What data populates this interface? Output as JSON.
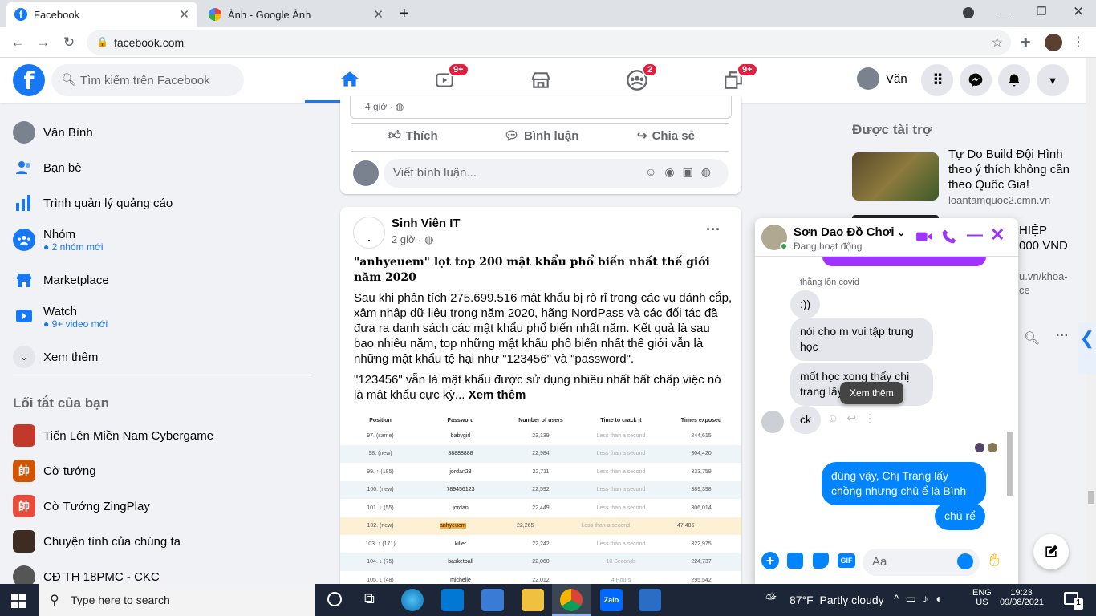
{
  "browser": {
    "tabs": [
      {
        "title": "Facebook"
      },
      {
        "title": "Ảnh - Google Ảnh"
      }
    ],
    "url": "facebook.com"
  },
  "header": {
    "search_placeholder": "Tìm kiếm trên Facebook",
    "user_name": "Văn",
    "badges": {
      "watch": "9+",
      "groups": "2",
      "gaming": "9+"
    }
  },
  "sidebar": {
    "items": [
      {
        "label": "Văn Bình",
        "sub": ""
      },
      {
        "label": "Bạn bè",
        "sub": ""
      },
      {
        "label": "Trình quản lý quảng cáo",
        "sub": ""
      },
      {
        "label": "Nhóm",
        "sub": "2 nhóm mới"
      },
      {
        "label": "Marketplace",
        "sub": ""
      },
      {
        "label": "Watch",
        "sub": "9+ video mới"
      },
      {
        "label": "Xem thêm",
        "sub": ""
      }
    ],
    "shortcuts_title": "Lối tắt của bạn",
    "shortcuts": [
      {
        "label": "Tiến Lên Miền Nam Cybergame"
      },
      {
        "label": "Cờ tướng"
      },
      {
        "label": "Cờ Tướng ZingPlay"
      },
      {
        "label": "Chuyện tình của chúng ta"
      },
      {
        "label": "CĐ TH 18PMC - CKC"
      }
    ]
  },
  "post1": {
    "time": "4 giờ ·",
    "like": "Thích",
    "comment": "Bình luận",
    "share": "Chia sẻ",
    "comment_placeholder": "Viết bình luận..."
  },
  "post2": {
    "author": "Sinh Viên IT",
    "time": "2 giờ ·",
    "headline": "\"anhyeuem\" lọt top 200 mật khẩu phổ biến nhất thế giới năm 2020",
    "body1": "Sau khi phân tích 275.699.516 mật khẩu bị rò rỉ trong các vụ đánh cắp, xâm nhập dữ liệu trong năm 2020, hãng NordPass và các đối tác đã đưa ra danh sách các mật khẩu phổ biến nhất năm. Kết quả là sau bao nhiêu năm, top những mật khẩu phổ biến nhất thế giới vẫn là những mật khẩu tệ hại như \"123456\" và \"password\".",
    "body2": "\"123456\" vẫn là mật khẩu được sử dụng nhiều nhất bất chấp việc nó là mật khẩu cực kỳ...",
    "see_more": "Xem thêm",
    "table": {
      "headers": [
        "Position",
        "Password",
        "Number of users",
        "Time to crack it",
        "Times exposed"
      ],
      "rows": [
        [
          "97. (same)",
          "babygirl",
          "23,139",
          "Less than a second",
          "244,615"
        ],
        [
          "98. (new)",
          "88888888",
          "22,984",
          "Less than a second",
          "304,420"
        ],
        [
          "99. ↑ (185)",
          "jordan23",
          "22,711",
          "Less than a second",
          "333,759"
        ],
        [
          "100. (new)",
          "789456123",
          "22,592",
          "Less than a second",
          "389,398"
        ],
        [
          "101. ↓ (55)",
          "jordan",
          "22,449",
          "Less than a second",
          "306,014"
        ],
        [
          "102. (new)",
          "anhyeuem",
          "22,265",
          "Less than a second",
          "47,486"
        ],
        [
          "103. ↑ (171)",
          "killer",
          "22,242",
          "Less than a second",
          "322,975"
        ],
        [
          "104. ↓ (75)",
          "basketball",
          "22,060",
          "10 Seconds",
          "224,737"
        ],
        [
          "105. ↓ (48)",
          "michelle",
          "22,012",
          "4 Hours",
          "295,542"
        ]
      ]
    }
  },
  "right": {
    "sponsored_title": "Được tài trợ",
    "ad1_title": "Tự Do Build Đội Hình theo ý thích không cần theo Quốc Gia!",
    "ad1_domain": "loantamquoc2.cmn.vn",
    "ad2_frag1": "HIỆP",
    "ad2_frag2": "000 VND",
    "ad2_frag3": "u.vn/khoa-",
    "ad2_frag4": "ce"
  },
  "chat": {
    "name": "Sơn Dao Đồ Chơi",
    "status": "Đang hoạt động",
    "sender_label": "thằng lồn covid",
    "messages": [
      {
        "text": ":))"
      },
      {
        "text": "nói cho m vui tập trung học"
      },
      {
        "text": "mốt học xong thấy chị trang lấy ck"
      },
      {
        "text": "ck"
      },
      {
        "text": "đúng vậy, Chị Trang lấy chồng nhưng chú ể là Bình"
      },
      {
        "text": "chú rể"
      }
    ],
    "tooltip": "Xem thêm",
    "input_placeholder": "Aa"
  },
  "taskbar": {
    "search_placeholder": "Type here to search",
    "weather": "87°F  Partly cloudy",
    "lang1": "ENG",
    "lang2": "US",
    "time": "19:23",
    "date": "09/08/2021",
    "notifications": "1"
  },
  "colors": {
    "fb_blue": "#1877f2",
    "messenger_purple": "#a033ff",
    "chat_bubble": "#0084ff"
  }
}
